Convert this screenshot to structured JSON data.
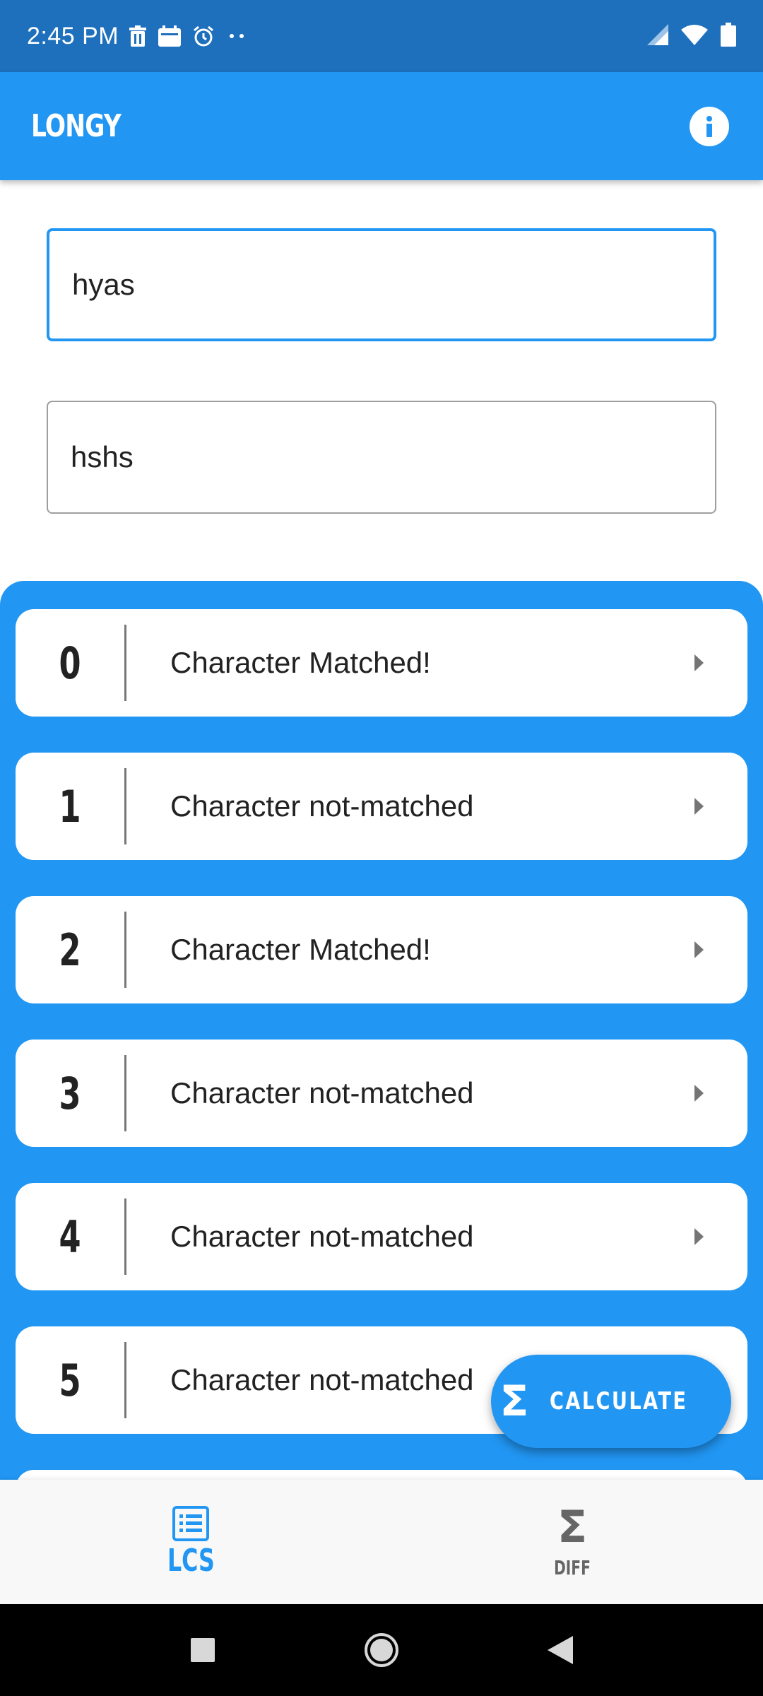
{
  "status_bar": {
    "time": "2:45 PM",
    "left_icons": [
      "trash-icon",
      "calendar-icon",
      "alarm-icon",
      "more-dots-icon"
    ],
    "right_icons": [
      "signal-icon",
      "wifi-icon",
      "battery-icon"
    ]
  },
  "app_bar": {
    "title": "LONGY",
    "action_icon": "info-icon"
  },
  "inputs": {
    "first_value": "hyas",
    "second_value": "hshs"
  },
  "results": [
    {
      "index": "0",
      "label": "Character Matched!"
    },
    {
      "index": "1",
      "label": "Character not-matched"
    },
    {
      "index": "2",
      "label": "Character Matched!"
    },
    {
      "index": "3",
      "label": "Character not-matched"
    },
    {
      "index": "4",
      "label": "Character not-matched"
    },
    {
      "index": "5",
      "label": "Character not-matched"
    }
  ],
  "fab": {
    "icon": "sigma-icon",
    "label": "CALCULATE"
  },
  "bottom_nav": {
    "items": [
      {
        "label": "LCS",
        "icon": "list-icon",
        "active": true
      },
      {
        "label": "DIFF",
        "icon": "sigma-icon",
        "active": false
      }
    ]
  },
  "colors": {
    "primary": "#2196f3",
    "status_bar": "#1e70bd",
    "card": "#ffffff",
    "text": "#222222"
  }
}
